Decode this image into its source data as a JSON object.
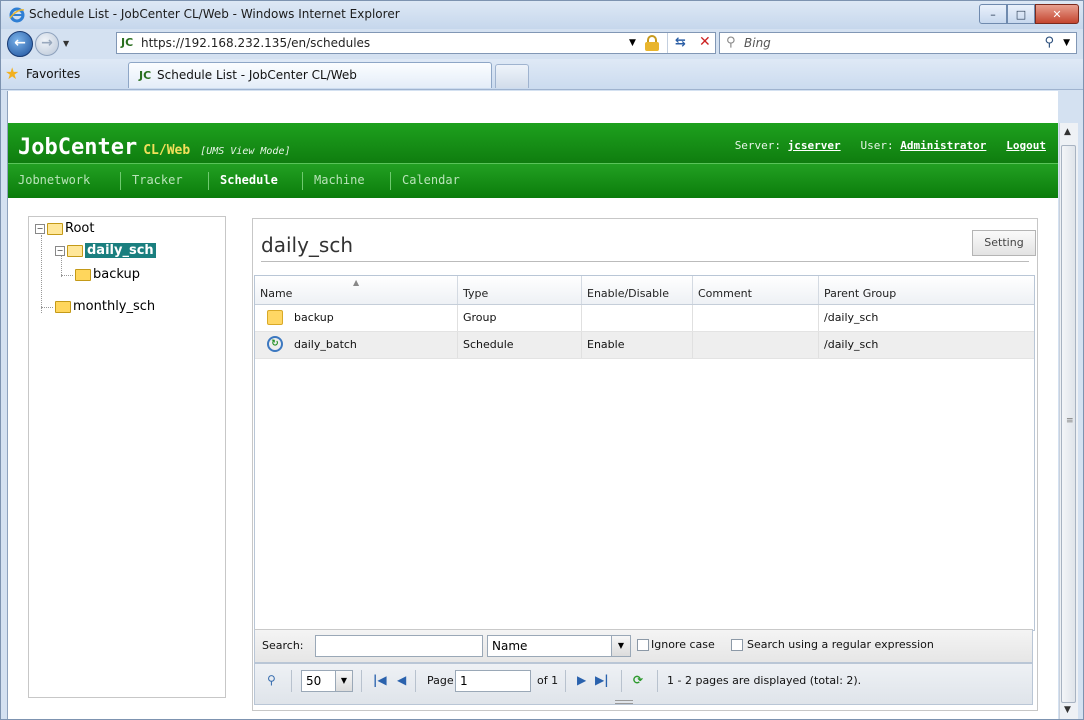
{
  "window": {
    "title": "Schedule List - JobCenter CL/Web - Windows Internet Explorer",
    "controls": {
      "minimize": "–",
      "maximize": "□",
      "close": "✕"
    }
  },
  "browser": {
    "favicon_text": "JC",
    "url": "https://192.168.232.135/en/schedules",
    "search_placeholder": "Bing",
    "favorites_label": "Favorites",
    "tab_label": "Schedule List - JobCenter CL/Web"
  },
  "app": {
    "brand": "JobCenter",
    "brand_suffix": "CL/Web",
    "mode": "[UMS View Mode]",
    "server_label": "Server:",
    "server_name": "jcserver",
    "user_label": "User:",
    "user_name": "Administrator",
    "logout": "Logout",
    "menu": [
      "Jobnetwork",
      "Tracker",
      "Schedule",
      "Machine",
      "Calendar"
    ],
    "active_menu": "Schedule"
  },
  "tree": {
    "root": "Root",
    "selected": "daily_sch",
    "child": "backup",
    "sibling": "monthly_sch"
  },
  "panel": {
    "title": "daily_sch",
    "setting_button": "Setting"
  },
  "grid": {
    "columns": [
      "Name",
      "Type",
      "Enable/Disable",
      "Comment",
      "Parent Group"
    ],
    "rows": [
      {
        "icon": "folder-icon",
        "name": "backup",
        "type": "Group",
        "enable": "",
        "comment": "",
        "parent": "/daily_sch"
      },
      {
        "icon": "schedule-icon",
        "name": "daily_batch",
        "type": "Schedule",
        "enable": "Enable",
        "comment": "",
        "parent": "/daily_sch"
      }
    ]
  },
  "search": {
    "label": "Search:",
    "value": "",
    "field_selected": "Name",
    "ignore_case": "Ignore case",
    "regex": "Search using a regular expression"
  },
  "pager": {
    "page_size": "50",
    "page_label": "Page",
    "page_value": "1",
    "of_label": "of 1",
    "status": "1 - 2 pages are displayed (total: 2)."
  }
}
